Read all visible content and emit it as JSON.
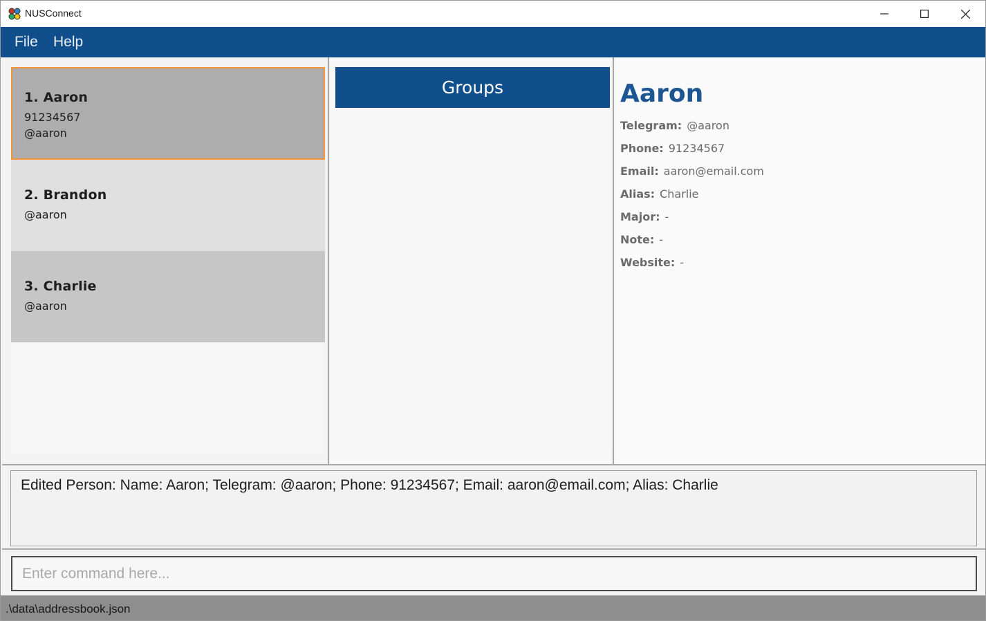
{
  "window": {
    "title": "NUSConnect",
    "icon": "app-logo-icon",
    "controls": [
      "minimize-icon",
      "maximize-icon",
      "close-icon"
    ]
  },
  "menu": {
    "items": [
      {
        "label": "File"
      },
      {
        "label": "Help"
      }
    ]
  },
  "person_list": {
    "items": [
      {
        "name": "1. Aaron",
        "lines": [
          "91234567",
          "@aaron"
        ],
        "selected": true
      },
      {
        "name": "2. Brandon",
        "lines": [
          "@aaron"
        ],
        "selected": false
      },
      {
        "name": "3. Charlie",
        "lines": [
          "@aaron"
        ],
        "selected": false
      }
    ]
  },
  "groups": {
    "header": "Groups"
  },
  "details": {
    "name": "Aaron",
    "fields": [
      {
        "label": "Telegram:",
        "value": "@aaron"
      },
      {
        "label": "Phone:",
        "value": "91234567"
      },
      {
        "label": "Email:",
        "value": "aaron@email.com"
      },
      {
        "label": "Alias:",
        "value": "Charlie"
      },
      {
        "label": "Major:",
        "value": "-"
      },
      {
        "label": "Note:",
        "value": "-"
      },
      {
        "label": "Website:",
        "value": "-"
      }
    ]
  },
  "result": {
    "text": "Edited Person: Name: Aaron; Telegram: @aaron; Phone: 91234567; Email: aaron@email.com; Alias: Charlie"
  },
  "command": {
    "value": "",
    "placeholder": "Enter command here..."
  },
  "status": {
    "path": ".\\data\\addressbook.json"
  },
  "colors": {
    "accent": "#114f8c",
    "selected_card": "#adadad",
    "selected_border": "#f0953a",
    "card_alt_1": "#e0e0e0",
    "card_alt_2": "#c6c6c6",
    "detail_name": "#1c5591",
    "status_bar": "#8e8e8e"
  }
}
